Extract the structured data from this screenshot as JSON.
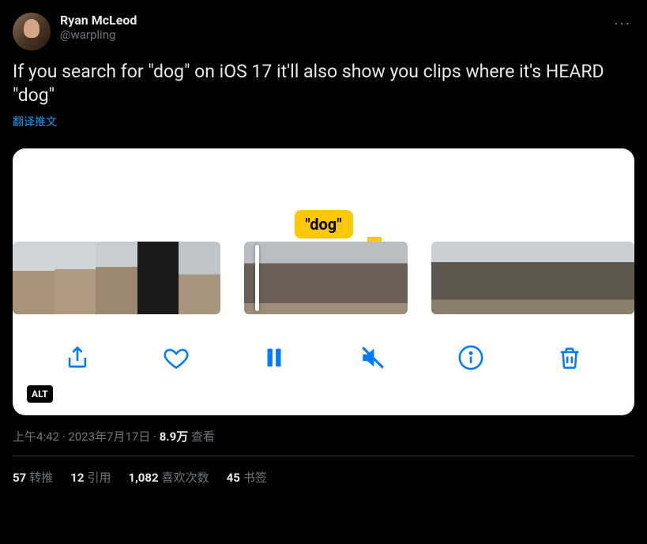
{
  "author": {
    "display_name": "Ryan McLeod",
    "handle": "@warpling"
  },
  "tweet_text": "If you search for \"dog\" on iOS 17 it'll also show you clips where it's HEARD \"dog\"",
  "translate_label": "翻译推文",
  "media": {
    "search_label": "\"dog\"",
    "alt_badge": "ALT"
  },
  "meta": {
    "time": "上午4:42",
    "date": "2023年7月17日",
    "views_count": "8.9万",
    "views_label": "查看",
    "sep": " · "
  },
  "stats": {
    "retweets": {
      "count": "57",
      "label": "转推"
    },
    "quotes": {
      "count": "12",
      "label": "引用"
    },
    "likes": {
      "count": "1,082",
      "label": "喜欢次数"
    },
    "bookmarks": {
      "count": "45",
      "label": "书签"
    }
  },
  "more_glyph": "···"
}
